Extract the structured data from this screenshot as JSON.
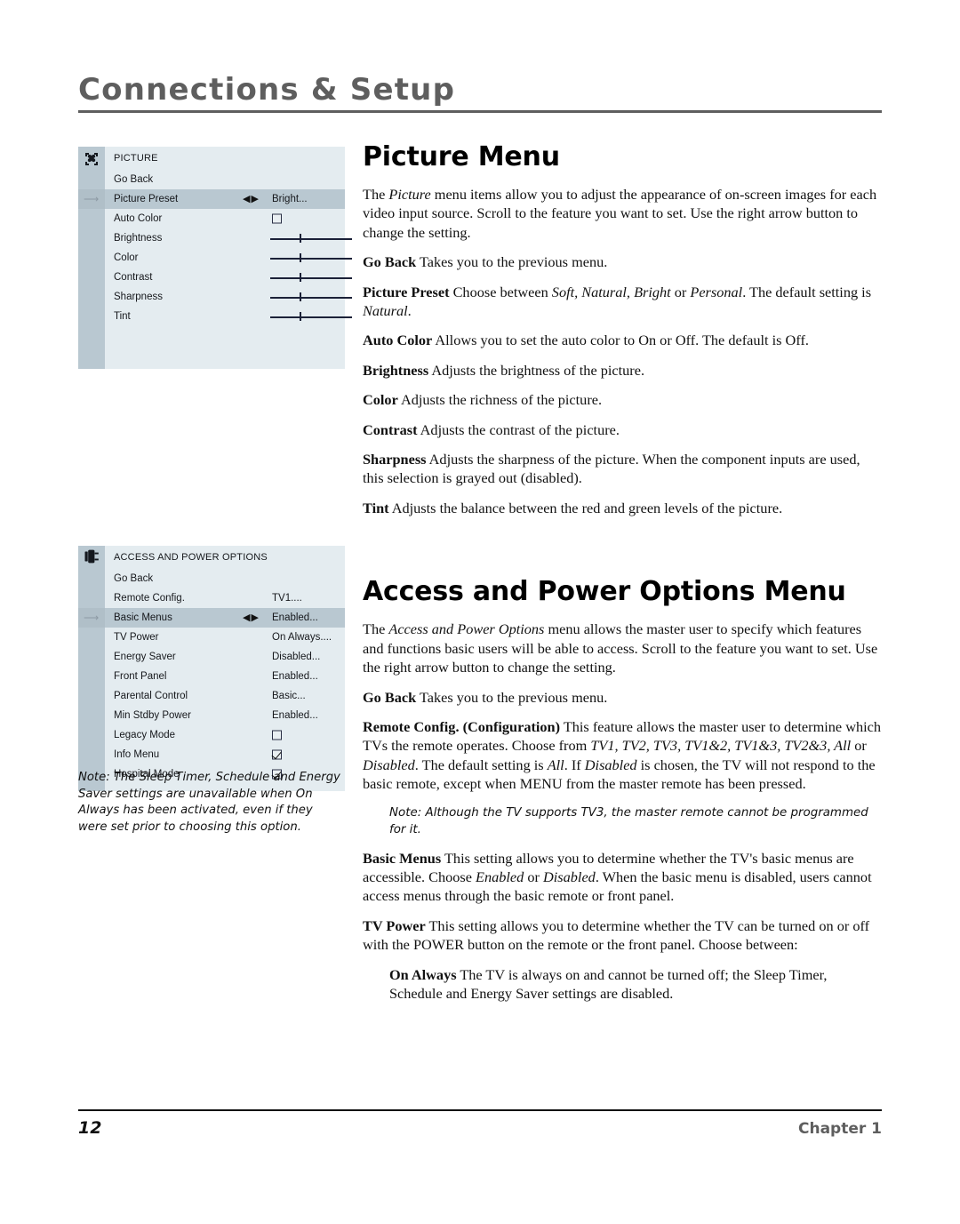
{
  "header": {
    "running_head": "Connections & Setup"
  },
  "picture_menu_osd": {
    "icon": "picture-butterfly-icon",
    "title": "PICTURE",
    "rows": [
      {
        "label": "Go Back",
        "type": "plain",
        "value": ""
      },
      {
        "label": "Picture Preset",
        "type": "value",
        "value": "Bright...",
        "arrows": "◀▶",
        "selected": true
      },
      {
        "label": "Auto Color",
        "type": "checkbox",
        "checked": false
      },
      {
        "label": "Brightness",
        "type": "slider",
        "position": 36
      },
      {
        "label": "Color",
        "type": "slider",
        "position": 36
      },
      {
        "label": "Contrast",
        "type": "slider",
        "position": 36
      },
      {
        "label": "Sharpness",
        "type": "slider",
        "position": 36
      },
      {
        "label": "Tint",
        "type": "slider",
        "position": 36
      }
    ]
  },
  "access_menu_osd": {
    "icon": "power-plug-icon",
    "title": "ACCESS AND POWER OPTIONS",
    "rows": [
      {
        "label": "Go Back",
        "type": "plain",
        "value": ""
      },
      {
        "label": "Remote Config.",
        "type": "value",
        "value": "TV1...."
      },
      {
        "label": "Basic Menus",
        "type": "value",
        "value": "Enabled...",
        "arrows": "◀▶",
        "selected": true
      },
      {
        "label": "TV Power",
        "type": "value",
        "value": "On Always...."
      },
      {
        "label": "Energy Saver",
        "type": "value",
        "value": "Disabled..."
      },
      {
        "label": "Front Panel",
        "type": "value",
        "value": "Enabled..."
      },
      {
        "label": "Parental Control",
        "type": "value",
        "value": "Basic..."
      },
      {
        "label": "Min Stdby Power",
        "type": "value",
        "value": "Enabled..."
      },
      {
        "label": "Legacy Mode",
        "type": "checkbox",
        "checked": false
      },
      {
        "label": "Info Menu",
        "type": "checkbox",
        "checked": true
      },
      {
        "label": "Hospital Mode",
        "type": "checkbox",
        "checked": true
      }
    ]
  },
  "left_note": "Note: The Sleep Timer, Schedule and Energy Saver settings are unavailable when On Always has been activated, even if they were set prior to choosing this option.",
  "picture_section": {
    "heading": "Picture Menu",
    "intro_a": "The ",
    "intro_b": "Picture",
    "intro_c": " menu items allow you to adjust the appearance of on-screen images for each video input source. Scroll to the feature you want to set. Use the right arrow button to change the setting.",
    "go_back_term": "Go Back",
    "go_back_text": "   Takes you to the previous menu.",
    "preset_term": "Picture Preset",
    "preset_text_a": "   Choose between ",
    "preset_text_b": "Soft, Natural, Bright",
    "preset_text_c": " or ",
    "preset_text_d": "Personal",
    "preset_text_e": ". The default setting is ",
    "preset_text_f": "Natural",
    "preset_text_g": ".",
    "auto_color_term": "Auto Color",
    "auto_color_text": "   Allows you to set the auto color to On or Off. The default is Off.",
    "brightness_term": "Brightness",
    "brightness_text": "   Adjusts the brightness of the picture.",
    "color_term": "Color",
    "color_text": "   Adjusts the richness of the picture.",
    "contrast_term": "Contrast",
    "contrast_text": "   Adjusts the contrast of the picture.",
    "sharpness_term": "Sharpness",
    "sharpness_text": "   Adjusts the sharpness of the picture. When the component inputs are used, this selection is grayed out (disabled).",
    "tint_term": "Tint",
    "tint_text": "   Adjusts the balance between the red and green levels of the picture."
  },
  "access_section": {
    "heading": "Access and Power Options Menu",
    "intro_a": "The ",
    "intro_b": "Access and Power Options",
    "intro_c": " menu allows the master user to specify which features and functions basic users will be able to access. Scroll to the feature you want to set. Use the right arrow button to change the setting.",
    "go_back_term": "Go Back",
    "go_back_text": "   Takes you to the previous menu.",
    "remote_term": "Remote Config",
    "remote_term2": ". (Configuration)",
    "remote_text_a": "   This feature allows the master user to determine which TVs the remote operates. Choose from ",
    "remote_text_b": "TV1, TV2, TV3, TV1&2, TV1&3, TV2&3, All",
    "remote_text_c": " or ",
    "remote_text_d": "Disabled",
    "remote_text_e": ". The default setting is ",
    "remote_text_f": "All",
    "remote_text_g": ". If ",
    "remote_text_h": "Disabled",
    "remote_text_i": " is chosen, the TV will not respond to the basic remote, except when MENU from the master remote has been pressed.",
    "note_tv3": "Note: Although the TV supports TV3, the master remote cannot be programmed for it.",
    "basic_menus_term": "Basic Menus",
    "basic_menus_text_a": "   This setting allows you to determine whether the TV's basic menus are accessible. Choose ",
    "basic_menus_text_b": "Enabled",
    "basic_menus_text_c": " or ",
    "basic_menus_text_d": "Disabled",
    "basic_menus_text_e": ". When the basic menu is disabled, users cannot access menus through the basic remote or front panel.",
    "tv_power_term": "TV Power",
    "tv_power_text": "   This setting allows you to determine whether the TV can be turned on or off with the POWER button on the remote or the front panel. Choose between:",
    "on_always_term": "On Always",
    "on_always_text": "   The TV is always on and cannot be turned off; the Sleep Timer, Schedule and Energy Saver settings are disabled."
  },
  "footer": {
    "page_number": "12",
    "chapter": "Chapter 1"
  },
  "colors": {
    "osd_background": "#e4ecf0",
    "osd_rail": "#b9c8d1",
    "osd_selected": "#b9c8d1",
    "header_gray": "#5e5e5e",
    "slider": "#1b2138"
  }
}
